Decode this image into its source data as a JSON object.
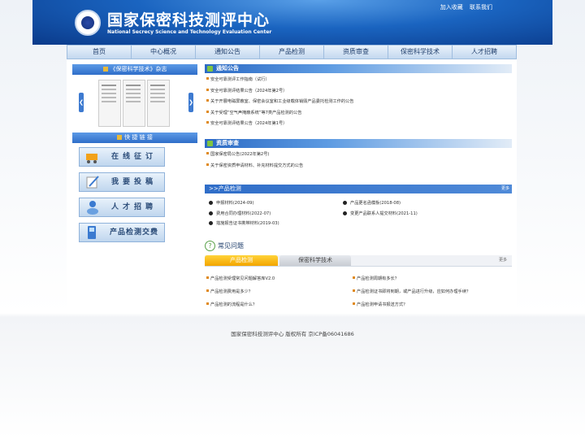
{
  "header": {
    "title_cn": "国家保密科技测评中心",
    "title_en": "National Secrecy Science and Technology Evaluation Center"
  },
  "toplinks": [
    "加入收藏",
    "联系我们"
  ],
  "nav": [
    "首页",
    "中心概况",
    "通知公告",
    "产品检测",
    "资质审查",
    "保密科学技术",
    "人才招聘"
  ],
  "sidebar": {
    "magazine_title": "《保密科学技术》杂志",
    "arrow_left": "❮",
    "arrow_right": "❯",
    "quick_title": "快 捷 链 接",
    "quick_links": [
      "在线征订",
      "我要投稿",
      "人才招聘",
      "产品检测交费"
    ]
  },
  "notices": {
    "title": "通知公告",
    "items": [
      "安全可靠测评工作指南（试行）",
      "安全可靠测评结果公告（2024年第2号）",
      "关于开展电磁屏蔽室、保密会议室和工业级载体销毁产品委托检测工作的公告",
      "关于受理“空气声掩蔽系统”等7类产品检测的公告",
      "安全可靠测评结果公告（2024年第1号）"
    ]
  },
  "qualification": {
    "title": "资质审查",
    "items": [
      "国家保密局公告(2022年第2号)",
      "关于保密资质申请材料、补充材料提交方式的公告"
    ]
  },
  "products": {
    "title": ">>产品检测",
    "more": "更多",
    "left": [
      "申报材料(2024-09)",
      "费用合同办理材料(2022-07)",
      "措施报告证书携带材料(2019-03)"
    ],
    "right": [
      "产品更名函模板(2018-08)",
      "变更产品联系人提交材料(2021-11)"
    ]
  },
  "faq": {
    "title": "常见问题",
    "q_icon": "?",
    "tab_active": "产品检测",
    "tab_inactive": "保密科学技术",
    "more": "更多",
    "left": [
      "产品检测受理常见问题解答库V2.0",
      "产品检测费用是多少？",
      "产品检测的流程是什么？"
    ],
    "right": [
      "产品检测周期有多长？",
      "产品检测证书即将到期，或产品进行升级，应如何办理手续？",
      "产品检测申请书报送方式？"
    ]
  },
  "footer": "国家保密科技测评中心    版权所有    京ICP备06041686"
}
